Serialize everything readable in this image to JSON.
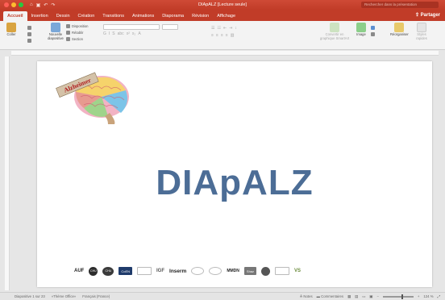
{
  "window": {
    "title": "DIApALZ [Lecture seule]"
  },
  "search": {
    "placeholder": "Rechercher dans la présentation"
  },
  "share_label": "Partager",
  "tabs": [
    {
      "label": "Accueil",
      "active": true
    },
    {
      "label": "Insertion"
    },
    {
      "label": "Dessin"
    },
    {
      "label": "Création"
    },
    {
      "label": "Transitions"
    },
    {
      "label": "Animations"
    },
    {
      "label": "Diaporama"
    },
    {
      "label": "Révision"
    },
    {
      "label": "Affichage"
    }
  ],
  "ribbon": {
    "paste": "Coller",
    "new_slide": "Nouvelle diapositive",
    "layout": "Disposition",
    "reset": "Rétablir",
    "section": "Section",
    "convert_smartart": "Convertir en graphique SmartArt",
    "image": "Image",
    "arrange": "Réorganiser",
    "quick_styles": "Styles rapides"
  },
  "slide": {
    "logo_text": "Alzheimer",
    "title": "DIApALZ",
    "partner_logos": [
      "AUF",
      "CHU",
      "CHU",
      "CoEN",
      "",
      "IGF",
      "Inserm",
      "",
      "",
      "MMDN",
      "Shaz",
      "",
      "",
      "VS"
    ],
    "partner_inserm": "Inserm"
  },
  "status": {
    "slide_count": "Diapositive 1 sur 23",
    "theme": "«Thème Office»",
    "language": "Français (France)",
    "notes": "Notes",
    "comments": "Commentaires",
    "zoom": "124 %",
    "zoom_fraction": 0.6
  },
  "colors": {
    "accent": "#c13c28",
    "title_blue": "#4c6d96"
  }
}
